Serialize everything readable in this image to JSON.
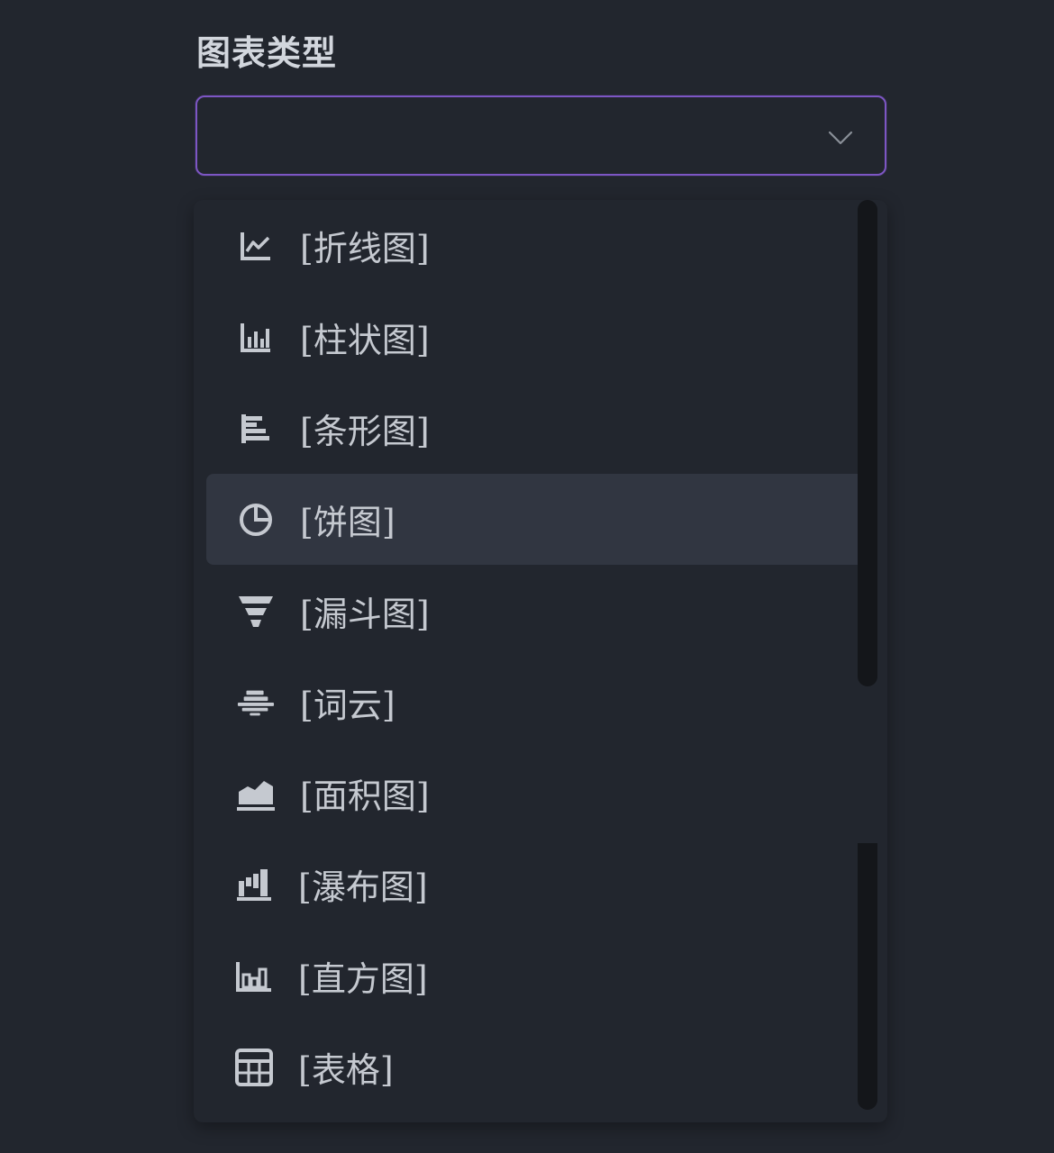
{
  "field": {
    "label": "图表类型",
    "selected_value": ""
  },
  "dropdown": {
    "hovered_index": 3,
    "options": [
      {
        "label": "[折线图]",
        "icon": "line-chart-icon"
      },
      {
        "label": "[柱状图]",
        "icon": "column-chart-icon"
      },
      {
        "label": "[条形图]",
        "icon": "bar-chart-icon"
      },
      {
        "label": "[饼图]",
        "icon": "pie-chart-icon"
      },
      {
        "label": "[漏斗图]",
        "icon": "funnel-chart-icon"
      },
      {
        "label": "[词云]",
        "icon": "word-cloud-icon"
      },
      {
        "label": "[面积图]",
        "icon": "area-chart-icon"
      },
      {
        "label": "[瀑布图]",
        "icon": "waterfall-chart-icon"
      },
      {
        "label": "[直方图]",
        "icon": "histogram-icon"
      },
      {
        "label": "[表格]",
        "icon": "table-icon"
      }
    ]
  },
  "colors": {
    "background": "#22262e",
    "accent_border": "#7d56c4",
    "hover_row": "#313641",
    "text": "#c5c9d0",
    "scrollbar": "#14161a"
  }
}
